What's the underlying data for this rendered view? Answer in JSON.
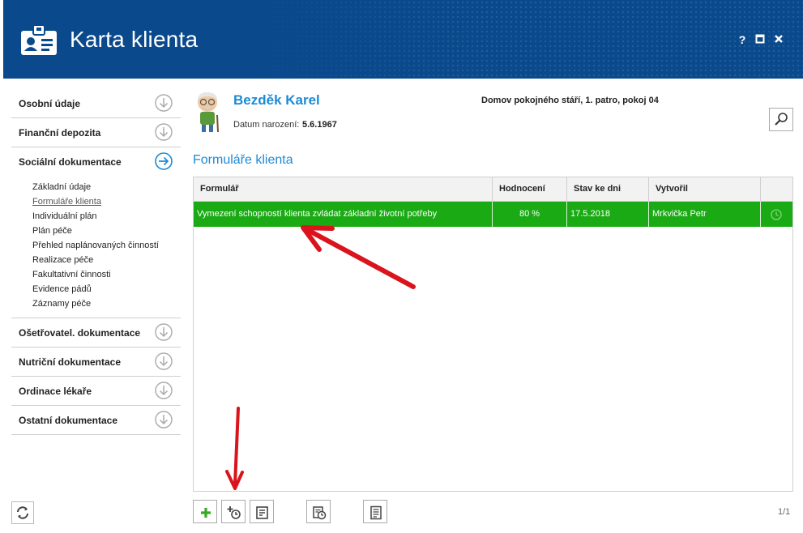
{
  "window": {
    "title": "Karta klienta",
    "help_label": "?",
    "maximize_label": "▣",
    "close_label": "✕"
  },
  "sidebar": {
    "items": [
      {
        "label": "Osobní údaje"
      },
      {
        "label": "Finanční depozita"
      },
      {
        "label": "Sociální dokumentace"
      },
      {
        "label": "Ošetřovatel. dokumentace"
      },
      {
        "label": "Nutriční dokumentace"
      },
      {
        "label": "Ordinace lékaře"
      },
      {
        "label": "Ostatní dokumentace"
      }
    ],
    "sub_items": [
      {
        "label": "Základní údaje"
      },
      {
        "label": "Formuláře klienta"
      },
      {
        "label": "Individuální plán"
      },
      {
        "label": "Plán péče"
      },
      {
        "label": "Přehled naplánovaných činností"
      },
      {
        "label": "Realizace péče"
      },
      {
        "label": "Fakultativní činnosti"
      },
      {
        "label": "Evidence pádů"
      },
      {
        "label": "Záznamy péče"
      }
    ]
  },
  "client": {
    "name": "Bezděk Karel",
    "dob_label": "Datum narození:",
    "dob_value": "5.6.1967",
    "location": "Domov pokojného stáří, 1. patro, pokoj 04"
  },
  "main": {
    "section_title": "Formuláře klienta",
    "table": {
      "headers": [
        "Formulář",
        "Hodnocení",
        "Stav ke dni",
        "Vytvořil"
      ],
      "rows": [
        {
          "form": "Vymezení schopností klienta zvládat základní životní potřeby",
          "rating": "80 %",
          "date": "17.5.2018",
          "author": "Mrkvička Petr"
        }
      ]
    },
    "pager": "1/1"
  },
  "colors": {
    "header_bg": "#0a4a8c",
    "accent_blue": "#1d8ad4",
    "selected_row": "#1aaa14",
    "annotation_red": "#d9141c"
  },
  "icons": {
    "app": "id-card-icon",
    "search": "search-icon",
    "add": "plus-icon",
    "add_scheduled": "add-clock-icon",
    "edit": "edit-form-icon",
    "history": "form-history-icon",
    "document": "document-icon",
    "refresh": "refresh-icon"
  }
}
